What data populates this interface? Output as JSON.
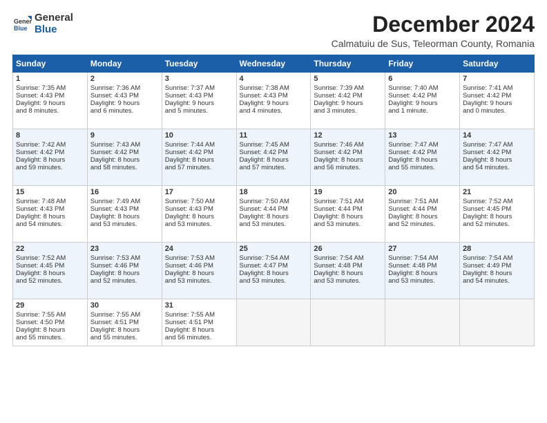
{
  "logo": {
    "general": "General",
    "blue": "Blue"
  },
  "title": "December 2024",
  "subtitle": "Calmatuiu de Sus, Teleorman County, Romania",
  "days": [
    "Sunday",
    "Monday",
    "Tuesday",
    "Wednesday",
    "Thursday",
    "Friday",
    "Saturday"
  ],
  "cells": [
    {
      "day": "",
      "empty": true
    },
    {
      "day": "",
      "empty": true
    },
    {
      "day": "",
      "empty": true
    },
    {
      "day": "",
      "empty": true
    },
    {
      "day": "",
      "empty": true
    },
    {
      "day": "",
      "empty": true
    },
    {
      "day": "",
      "empty": true
    },
    {
      "num": "1",
      "line1": "Sunrise: 7:35 AM",
      "line2": "Sunset: 4:43 PM",
      "line3": "Daylight: 9 hours",
      "line4": "and 8 minutes."
    },
    {
      "num": "2",
      "line1": "Sunrise: 7:36 AM",
      "line2": "Sunset: 4:43 PM",
      "line3": "Daylight: 9 hours",
      "line4": "and 6 minutes."
    },
    {
      "num": "3",
      "line1": "Sunrise: 7:37 AM",
      "line2": "Sunset: 4:43 PM",
      "line3": "Daylight: 9 hours",
      "line4": "and 5 minutes."
    },
    {
      "num": "4",
      "line1": "Sunrise: 7:38 AM",
      "line2": "Sunset: 4:43 PM",
      "line3": "Daylight: 9 hours",
      "line4": "and 4 minutes."
    },
    {
      "num": "5",
      "line1": "Sunrise: 7:39 AM",
      "line2": "Sunset: 4:42 PM",
      "line3": "Daylight: 9 hours",
      "line4": "and 3 minutes."
    },
    {
      "num": "6",
      "line1": "Sunrise: 7:40 AM",
      "line2": "Sunset: 4:42 PM",
      "line3": "Daylight: 9 hours",
      "line4": "and 1 minute."
    },
    {
      "num": "7",
      "line1": "Sunrise: 7:41 AM",
      "line2": "Sunset: 4:42 PM",
      "line3": "Daylight: 9 hours",
      "line4": "and 0 minutes."
    },
    {
      "num": "8",
      "line1": "Sunrise: 7:42 AM",
      "line2": "Sunset: 4:42 PM",
      "line3": "Daylight: 8 hours",
      "line4": "and 59 minutes."
    },
    {
      "num": "9",
      "line1": "Sunrise: 7:43 AM",
      "line2": "Sunset: 4:42 PM",
      "line3": "Daylight: 8 hours",
      "line4": "and 58 minutes."
    },
    {
      "num": "10",
      "line1": "Sunrise: 7:44 AM",
      "line2": "Sunset: 4:42 PM",
      "line3": "Daylight: 8 hours",
      "line4": "and 57 minutes."
    },
    {
      "num": "11",
      "line1": "Sunrise: 7:45 AM",
      "line2": "Sunset: 4:42 PM",
      "line3": "Daylight: 8 hours",
      "line4": "and 57 minutes."
    },
    {
      "num": "12",
      "line1": "Sunrise: 7:46 AM",
      "line2": "Sunset: 4:42 PM",
      "line3": "Daylight: 8 hours",
      "line4": "and 56 minutes."
    },
    {
      "num": "13",
      "line1": "Sunrise: 7:47 AM",
      "line2": "Sunset: 4:42 PM",
      "line3": "Daylight: 8 hours",
      "line4": "and 55 minutes."
    },
    {
      "num": "14",
      "line1": "Sunrise: 7:47 AM",
      "line2": "Sunset: 4:42 PM",
      "line3": "Daylight: 8 hours",
      "line4": "and 54 minutes."
    },
    {
      "num": "15",
      "line1": "Sunrise: 7:48 AM",
      "line2": "Sunset: 4:43 PM",
      "line3": "Daylight: 8 hours",
      "line4": "and 54 minutes."
    },
    {
      "num": "16",
      "line1": "Sunrise: 7:49 AM",
      "line2": "Sunset: 4:43 PM",
      "line3": "Daylight: 8 hours",
      "line4": "and 53 minutes."
    },
    {
      "num": "17",
      "line1": "Sunrise: 7:50 AM",
      "line2": "Sunset: 4:43 PM",
      "line3": "Daylight: 8 hours",
      "line4": "and 53 minutes."
    },
    {
      "num": "18",
      "line1": "Sunrise: 7:50 AM",
      "line2": "Sunset: 4:44 PM",
      "line3": "Daylight: 8 hours",
      "line4": "and 53 minutes."
    },
    {
      "num": "19",
      "line1": "Sunrise: 7:51 AM",
      "line2": "Sunset: 4:44 PM",
      "line3": "Daylight: 8 hours",
      "line4": "and 53 minutes."
    },
    {
      "num": "20",
      "line1": "Sunrise: 7:51 AM",
      "line2": "Sunset: 4:44 PM",
      "line3": "Daylight: 8 hours",
      "line4": "and 52 minutes."
    },
    {
      "num": "21",
      "line1": "Sunrise: 7:52 AM",
      "line2": "Sunset: 4:45 PM",
      "line3": "Daylight: 8 hours",
      "line4": "and 52 minutes."
    },
    {
      "num": "22",
      "line1": "Sunrise: 7:52 AM",
      "line2": "Sunset: 4:45 PM",
      "line3": "Daylight: 8 hours",
      "line4": "and 52 minutes."
    },
    {
      "num": "23",
      "line1": "Sunrise: 7:53 AM",
      "line2": "Sunset: 4:46 PM",
      "line3": "Daylight: 8 hours",
      "line4": "and 52 minutes."
    },
    {
      "num": "24",
      "line1": "Sunrise: 7:53 AM",
      "line2": "Sunset: 4:46 PM",
      "line3": "Daylight: 8 hours",
      "line4": "and 53 minutes."
    },
    {
      "num": "25",
      "line1": "Sunrise: 7:54 AM",
      "line2": "Sunset: 4:47 PM",
      "line3": "Daylight: 8 hours",
      "line4": "and 53 minutes."
    },
    {
      "num": "26",
      "line1": "Sunrise: 7:54 AM",
      "line2": "Sunset: 4:48 PM",
      "line3": "Daylight: 8 hours",
      "line4": "and 53 minutes."
    },
    {
      "num": "27",
      "line1": "Sunrise: 7:54 AM",
      "line2": "Sunset: 4:48 PM",
      "line3": "Daylight: 8 hours",
      "line4": "and 53 minutes."
    },
    {
      "num": "28",
      "line1": "Sunrise: 7:54 AM",
      "line2": "Sunset: 4:49 PM",
      "line3": "Daylight: 8 hours",
      "line4": "and 54 minutes."
    },
    {
      "num": "29",
      "line1": "Sunrise: 7:55 AM",
      "line2": "Sunset: 4:50 PM",
      "line3": "Daylight: 8 hours",
      "line4": "and 55 minutes."
    },
    {
      "num": "30",
      "line1": "Sunrise: 7:55 AM",
      "line2": "Sunset: 4:51 PM",
      "line3": "Daylight: 8 hours",
      "line4": "and 55 minutes."
    },
    {
      "num": "31",
      "line1": "Sunrise: 7:55 AM",
      "line2": "Sunset: 4:51 PM",
      "line3": "Daylight: 8 hours",
      "line4": "and 56 minutes."
    },
    {
      "day": "",
      "empty": true
    },
    {
      "day": "",
      "empty": true
    },
    {
      "day": "",
      "empty": true
    },
    {
      "day": "",
      "empty": true
    }
  ]
}
